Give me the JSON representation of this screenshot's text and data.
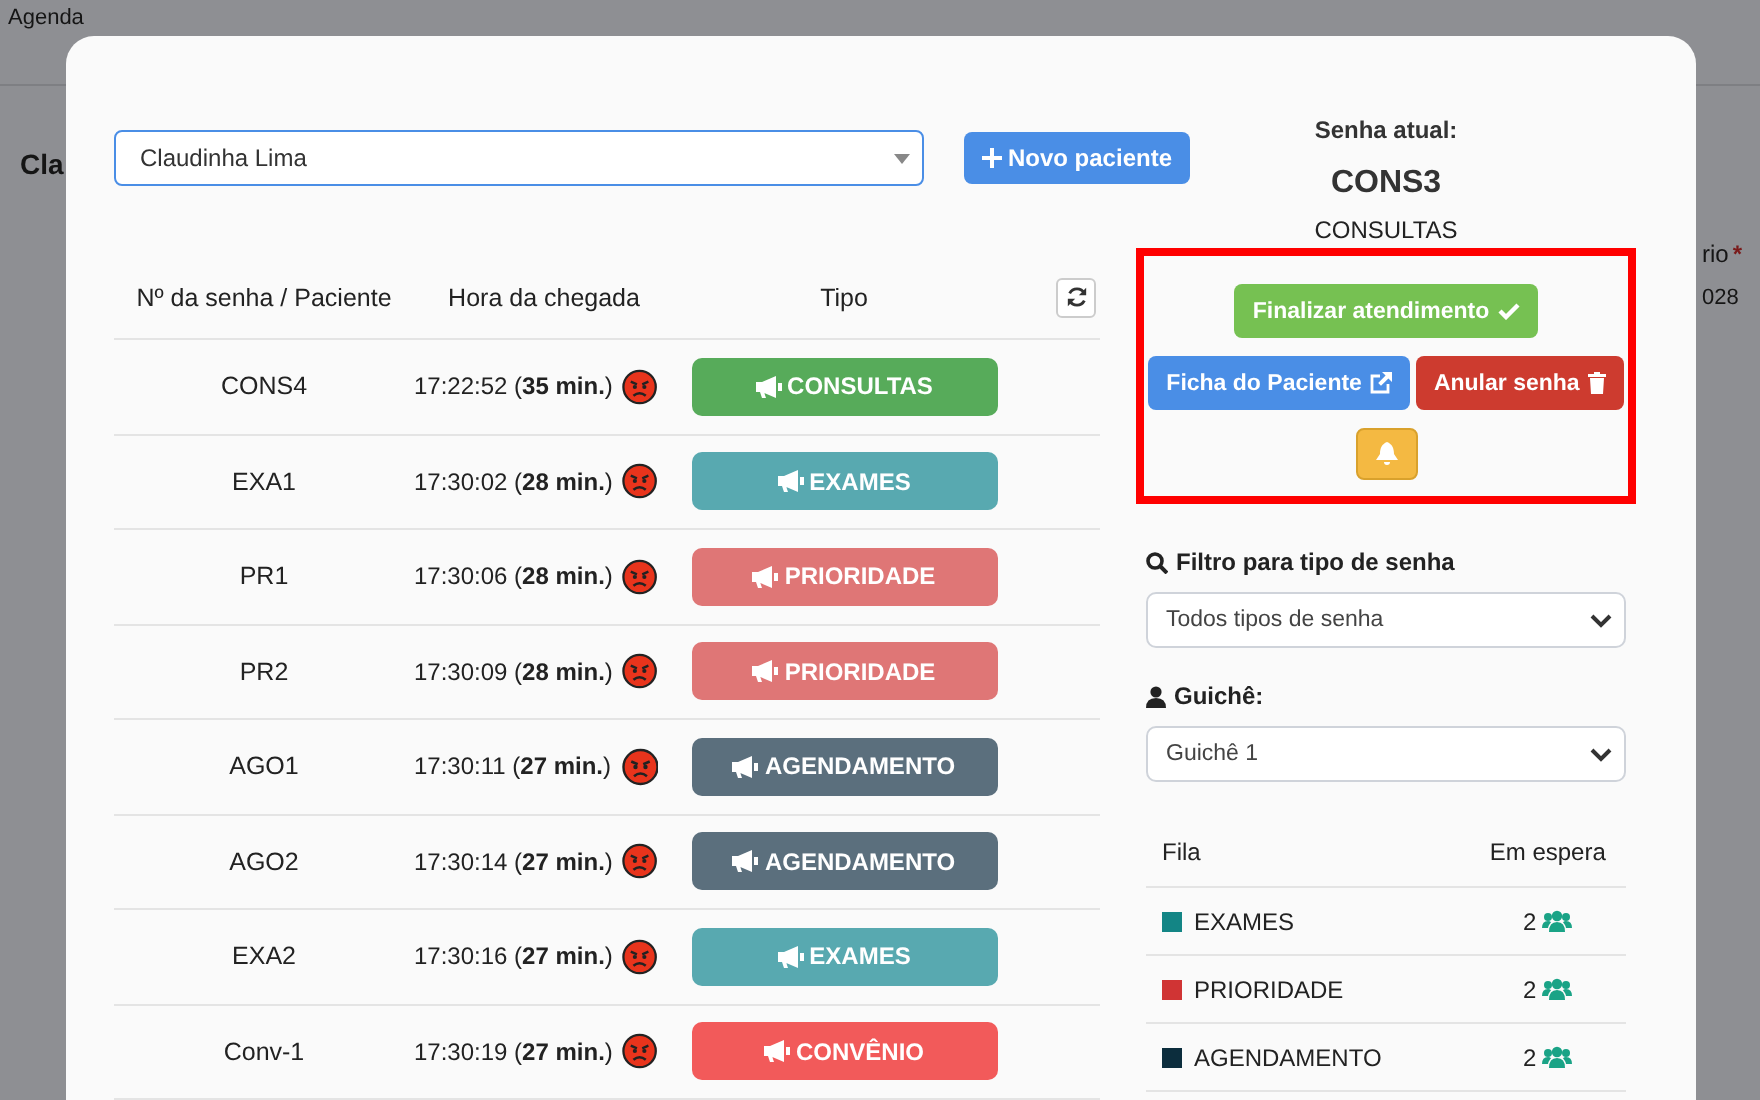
{
  "background": {
    "nav_label": "Agenda",
    "page_title": "Cla",
    "field_label": "rio",
    "required_mark": "*",
    "field_value": "028"
  },
  "patient_select": {
    "value": "Claudinha Lima"
  },
  "new_patient_button": {
    "label": "Novo paciente"
  },
  "tickets": {
    "columns": [
      "Nº da senha / Paciente",
      "Hora da chegada",
      "Tipo"
    ],
    "rows": [
      {
        "ticket": "CONS4",
        "arrival": "17:22:52 (**35 min.**)",
        "type": "CONSULTAS",
        "color": "#57ab5a"
      },
      {
        "ticket": "EXA1",
        "arrival": "17:30:02 (**28 min.**)",
        "type": "EXAMES",
        "color": "#58a9b0"
      },
      {
        "ticket": "PR1",
        "arrival": "17:30:06 (**28 min.**)",
        "type": "PRIORIDADE",
        "color": "#df7676"
      },
      {
        "ticket": "PR2",
        "arrival": "17:30:09 (**28 min.**)",
        "type": "PRIORIDADE",
        "color": "#df7676"
      },
      {
        "ticket": "AGO1",
        "arrival": "17:30:11 (**27 min.**)",
        "type": "AGENDAMENTO",
        "color": "#5b6f7d"
      },
      {
        "ticket": "AGO2",
        "arrival": "17:30:14 (**27 min.**)",
        "type": "AGENDAMENTO",
        "color": "#5b6f7d"
      },
      {
        "ticket": "EXA2",
        "arrival": "17:30:16 (**27 min.**)",
        "type": "EXAMES",
        "color": "#58a9b0"
      },
      {
        "ticket": "Conv-1",
        "arrival": "17:30:19 (**27 min.**)",
        "type": "CONVÊNIO",
        "color": "#f25a5a"
      }
    ]
  },
  "current": {
    "heading": "Senha atual:",
    "code": "CONS3",
    "type": "CONSULTAS"
  },
  "actions": [
    {
      "kind": "finish",
      "label": "Finalizar atendimento"
    },
    {
      "kind": "record",
      "label": "Ficha do Paciente"
    },
    {
      "kind": "cancel",
      "label": "Anular senha"
    },
    {
      "kind": "bell"
    }
  ],
  "filter": {
    "label": "Filtro para tipo de senha",
    "value": "Todos tipos de senha"
  },
  "counter": {
    "label": "Guichê:",
    "value": "Guichê 1"
  },
  "queue": {
    "columns": [
      "Fila",
      "Em espera"
    ],
    "rows": [
      {
        "name": "EXAMES",
        "count": "2",
        "color": "#138585"
      },
      {
        "name": "PRIORIDADE",
        "count": "2",
        "color": "#d03434"
      },
      {
        "name": "AGENDAMENTO",
        "count": "2",
        "color": "#0c2d3d"
      }
    ]
  }
}
